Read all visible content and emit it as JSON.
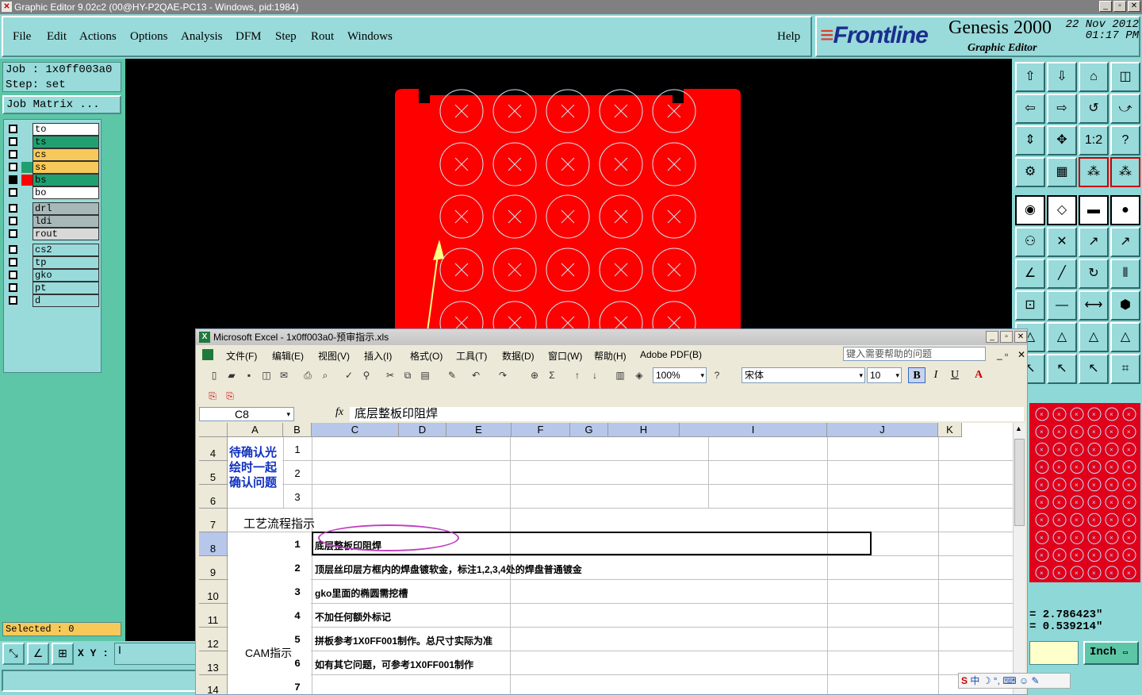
{
  "window": {
    "title": "Graphic Editor 9.02c2 (00@HY-P2QAE-PC13 - Windows, pid:1984)"
  },
  "menu": {
    "items": [
      "File",
      "Edit",
      "Actions",
      "Options",
      "Analysis",
      "DFM",
      "Step",
      "Rout",
      "Windows"
    ],
    "help": "Help"
  },
  "brand": {
    "logo": "Frontline",
    "product": "Genesis 2000",
    "subtitle": "Graphic Editor",
    "date": "22 Nov 2012",
    "time": "01:17 PM"
  },
  "job": {
    "job_line": "Job : 1x0ff003a0",
    "step_line": "Step: set",
    "matrix_button": "Job Matrix ..."
  },
  "layers": {
    "group1": [
      {
        "name": "to",
        "color": "#ffffff"
      },
      {
        "name": "ts",
        "color": "#20a070"
      },
      {
        "name": "cs",
        "color": "#f7c95a"
      },
      {
        "name": "ss",
        "color": "#f7c95a"
      },
      {
        "name": "bs",
        "color": "#20a070"
      },
      {
        "name": "bo",
        "color": "#ffffff"
      }
    ],
    "group2": [
      {
        "name": "drl",
        "color": "#a8b8b8"
      },
      {
        "name": "ldi",
        "color": "#a8b8b8"
      },
      {
        "name": "rout",
        "color": "#d8d8d8"
      }
    ],
    "group3": [
      {
        "name": "cs2",
        "color": "#99dada"
      },
      {
        "name": "tp",
        "color": "#99dada"
      },
      {
        "name": "gko",
        "color": "#99dada"
      },
      {
        "name": "pt",
        "color": "#99dada"
      },
      {
        "name": "d",
        "color": "#99dada"
      }
    ]
  },
  "status": {
    "selected": "Selected : 0",
    "xy_label": "X Y :",
    "xy_value": "I"
  },
  "coords": {
    "x": "= 2.786423\"",
    "y": "= 0.539214\"",
    "unit": "Inch"
  },
  "excel": {
    "title": "Microsoft Excel - 1x0ff003a0-预审指示.xls",
    "menu": [
      "文件(F)",
      "编辑(E)",
      "视图(V)",
      "插入(I)",
      "格式(O)",
      "工具(T)",
      "数据(D)",
      "窗口(W)",
      "帮助(H)",
      "Adobe PDF(B)"
    ],
    "help_placeholder": "键入需要帮助的问题",
    "zoom": "100%",
    "font": "宋体",
    "font_size": "10",
    "name_box": "C8",
    "formula": "底层整板印阻焊",
    "columns": [
      "A",
      "B",
      "C",
      "D",
      "E",
      "F",
      "G",
      "H",
      "I",
      "J",
      "K"
    ],
    "rows": [
      "4",
      "5",
      "6",
      "7",
      "8",
      "9",
      "10",
      "11",
      "12",
      "13",
      "14"
    ],
    "a_4": "待确认光绘时一起确认问题",
    "b_4": "1",
    "b_5": "2",
    "b_6": "3",
    "a_7": "工艺流程指示",
    "a_cam": "CAM指示",
    "cam_items": [
      {
        "no": "1",
        "text": "底层整板印阻焊"
      },
      {
        "no": "2",
        "text": "顶层丝印层方框内的焊盘镀软金，标注1,2,3,4处的焊盘普通镀金"
      },
      {
        "no": "3",
        "text": "gko里面的椭圆需挖槽"
      },
      {
        "no": "4",
        "text": "不加任何额外标记"
      },
      {
        "no": "5",
        "text": "拼板参考1X0FF001制作。总尺寸实际为准"
      },
      {
        "no": "6",
        "text": "如有其它问题，可参考1X0FF001制作"
      },
      {
        "no": "7",
        "text": ""
      }
    ]
  },
  "ime": {
    "label": "中"
  }
}
